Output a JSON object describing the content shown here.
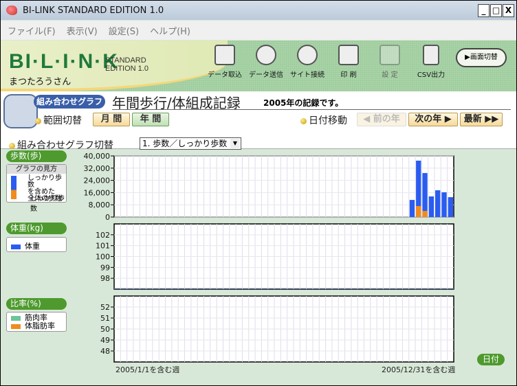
{
  "window": {
    "title": "BI-LINK STANDARD EDITION 1.0",
    "controls": [
      "_",
      "□",
      "X"
    ]
  },
  "menu": [
    "ファイル(F)",
    "表示(V)",
    "設定(S)",
    "ヘルプ(H)"
  ],
  "header": {
    "logo": "BI·L·I·N·K",
    "logo_sub1": "STANDARD",
    "logo_sub2": "EDITION 1.0",
    "user": "まつたろうさん",
    "tools": [
      {
        "label": "データ取込",
        "enabled": true
      },
      {
        "label": "データ送信",
        "enabled": true
      },
      {
        "label": "サイト接続",
        "enabled": true
      },
      {
        "label": "印 刷",
        "enabled": true
      },
      {
        "label": "設 定",
        "enabled": false
      },
      {
        "label": "CSV出力",
        "enabled": true
      }
    ],
    "switch_label": "画面切替"
  },
  "page": {
    "tag": "組み合わせグラフ",
    "title": "年間歩行/体組成記録",
    "subtitle": "2005年の記録です。",
    "range_label": "範囲切替",
    "range_buttons": [
      "月 間",
      "年 間"
    ],
    "range_selected": "年 間",
    "date_label": "日付移動",
    "prev": "◀ 前の年",
    "next": "次の年 ▶",
    "latest": "最新 ▶▶",
    "combo_label": "組み合わせグラフ切替",
    "combo_value": "1. 歩数／しっかり歩数"
  },
  "panels": {
    "steps": {
      "title": "歩数(歩)",
      "legend_title": "グラフの見方",
      "legend_lines": [
        "しっかり歩数",
        "を含めた",
        "全体の歩数"
      ],
      "legend_brisk": "しっかり歩数"
    },
    "weight": {
      "title": "体重(kg)",
      "legend": [
        "体重"
      ]
    },
    "ratio": {
      "title": "比率(%)",
      "legend": [
        "筋肉率",
        "体脂肪率"
      ]
    }
  },
  "colors": {
    "total_steps": "#2a5cf0",
    "brisk_steps": "#f08c1e",
    "muscle": "#6cc49a",
    "fat": "#f08c1e",
    "accent_green": "#4e9a2e"
  },
  "footer": {
    "start": "2005/1/1を含む週",
    "end": "2005/12/31を含む週",
    "date_button": "日付"
  },
  "chart_data": [
    {
      "type": "bar",
      "title": "歩数(歩)",
      "x_unit": "week",
      "weeks": 53,
      "ylim": [
        0,
        40000
      ],
      "yticks": [
        "40,000",
        "32,000",
        "24,000",
        "16,000",
        "8,000",
        "0"
      ],
      "series": [
        {
          "name": "しっかり歩数を含めた全体の歩数",
          "week_start": 47,
          "values": [
            11200,
            36900,
            28800,
            13500,
            17500,
            16200,
            13000
          ]
        },
        {
          "name": "しっかり歩数",
          "week_start": 47,
          "values": [
            0,
            7200,
            4000,
            0,
            0,
            0,
            0
          ]
        }
      ]
    },
    {
      "type": "line",
      "title": "体重(kg)",
      "ylim": [
        97,
        103
      ],
      "yticks": [
        "102",
        "101",
        "100",
        "99",
        "98"
      ],
      "series": [
        {
          "name": "体重",
          "values": []
        }
      ]
    },
    {
      "type": "bar",
      "title": "比率(%)",
      "ylim": [
        47,
        53
      ],
      "yticks": [
        "52",
        "51",
        "50",
        "49",
        "48"
      ],
      "series": [
        {
          "name": "筋肉率",
          "values": []
        },
        {
          "name": "体脂肪率",
          "values": []
        }
      ]
    }
  ]
}
